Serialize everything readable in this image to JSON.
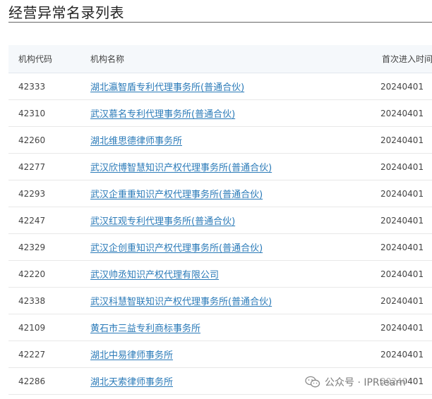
{
  "page": {
    "title": "经营异常名录列表"
  },
  "table": {
    "columns": {
      "code": "机构代码",
      "name": "机构名称",
      "date": "首次进入时间"
    },
    "rows": [
      {
        "code": "42333",
        "name": "湖北瀛智盾专利代理事务所(普通合伙)",
        "date": "20240401"
      },
      {
        "code": "42310",
        "name": "武汉慕名专利代理事务所(普通合伙)",
        "date": "20240401"
      },
      {
        "code": "42260",
        "name": "湖北维思德律师事务所",
        "date": "20240401"
      },
      {
        "code": "42277",
        "name": "武汉欣博智慧知识产权代理事务所(普通合伙)",
        "date": "20240401"
      },
      {
        "code": "42293",
        "name": "武汉企重重知识产权代理事务所(普通合伙)",
        "date": "20240401"
      },
      {
        "code": "42247",
        "name": "武汉红观专利代理事务所(普通合伙)",
        "date": "20240401"
      },
      {
        "code": "42329",
        "name": "武汉企创重知识产权代理事务所(普通合伙)",
        "date": "20240401"
      },
      {
        "code": "42220",
        "name": "武汉帅丞知识产权代理有限公司",
        "date": "20240401"
      },
      {
        "code": "42338",
        "name": "武汉科慧智联知识产权代理事务所(普通合伙)",
        "date": "20240401"
      },
      {
        "code": "42109",
        "name": "黄石市三益专利商标事务所",
        "date": "20240401"
      },
      {
        "code": "42227",
        "name": "湖北中易律师事务所",
        "date": "20240401"
      },
      {
        "code": "42286",
        "name": "湖北天索律师事务所",
        "date": "20240401"
      }
    ]
  },
  "watermark": {
    "text": "公众号 · IPRtearn",
    "icon": "wechat-icon"
  },
  "colors": {
    "link": "#2a7ab8",
    "header_bg": "#f5f8fb",
    "row_border": "#e8e8e8"
  }
}
